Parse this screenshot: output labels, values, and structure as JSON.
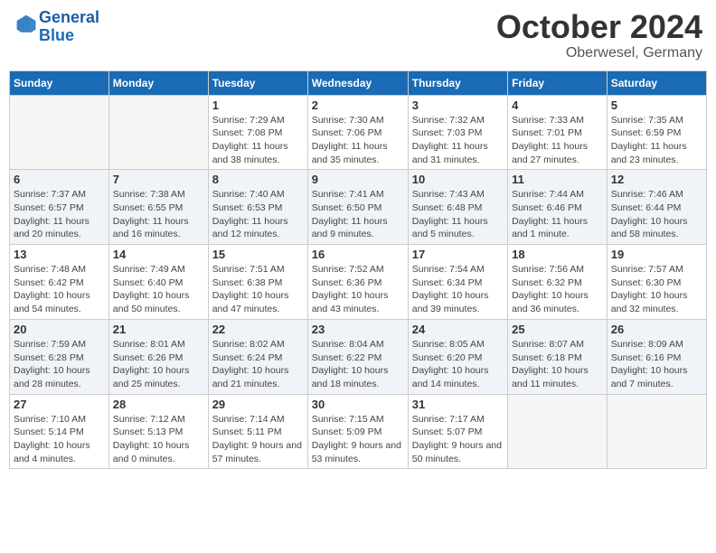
{
  "header": {
    "logo_line1": "General",
    "logo_line2": "Blue",
    "month": "October 2024",
    "location": "Oberwesel, Germany"
  },
  "weekdays": [
    "Sunday",
    "Monday",
    "Tuesday",
    "Wednesday",
    "Thursday",
    "Friday",
    "Saturday"
  ],
  "weeks": [
    [
      {
        "day": "",
        "info": ""
      },
      {
        "day": "",
        "info": ""
      },
      {
        "day": "1",
        "info": "Sunrise: 7:29 AM\nSunset: 7:08 PM\nDaylight: 11 hours and 38 minutes."
      },
      {
        "day": "2",
        "info": "Sunrise: 7:30 AM\nSunset: 7:06 PM\nDaylight: 11 hours and 35 minutes."
      },
      {
        "day": "3",
        "info": "Sunrise: 7:32 AM\nSunset: 7:03 PM\nDaylight: 11 hours and 31 minutes."
      },
      {
        "day": "4",
        "info": "Sunrise: 7:33 AM\nSunset: 7:01 PM\nDaylight: 11 hours and 27 minutes."
      },
      {
        "day": "5",
        "info": "Sunrise: 7:35 AM\nSunset: 6:59 PM\nDaylight: 11 hours and 23 minutes."
      }
    ],
    [
      {
        "day": "6",
        "info": "Sunrise: 7:37 AM\nSunset: 6:57 PM\nDaylight: 11 hours and 20 minutes."
      },
      {
        "day": "7",
        "info": "Sunrise: 7:38 AM\nSunset: 6:55 PM\nDaylight: 11 hours and 16 minutes."
      },
      {
        "day": "8",
        "info": "Sunrise: 7:40 AM\nSunset: 6:53 PM\nDaylight: 11 hours and 12 minutes."
      },
      {
        "day": "9",
        "info": "Sunrise: 7:41 AM\nSunset: 6:50 PM\nDaylight: 11 hours and 9 minutes."
      },
      {
        "day": "10",
        "info": "Sunrise: 7:43 AM\nSunset: 6:48 PM\nDaylight: 11 hours and 5 minutes."
      },
      {
        "day": "11",
        "info": "Sunrise: 7:44 AM\nSunset: 6:46 PM\nDaylight: 11 hours and 1 minute."
      },
      {
        "day": "12",
        "info": "Sunrise: 7:46 AM\nSunset: 6:44 PM\nDaylight: 10 hours and 58 minutes."
      }
    ],
    [
      {
        "day": "13",
        "info": "Sunrise: 7:48 AM\nSunset: 6:42 PM\nDaylight: 10 hours and 54 minutes."
      },
      {
        "day": "14",
        "info": "Sunrise: 7:49 AM\nSunset: 6:40 PM\nDaylight: 10 hours and 50 minutes."
      },
      {
        "day": "15",
        "info": "Sunrise: 7:51 AM\nSunset: 6:38 PM\nDaylight: 10 hours and 47 minutes."
      },
      {
        "day": "16",
        "info": "Sunrise: 7:52 AM\nSunset: 6:36 PM\nDaylight: 10 hours and 43 minutes."
      },
      {
        "day": "17",
        "info": "Sunrise: 7:54 AM\nSunset: 6:34 PM\nDaylight: 10 hours and 39 minutes."
      },
      {
        "day": "18",
        "info": "Sunrise: 7:56 AM\nSunset: 6:32 PM\nDaylight: 10 hours and 36 minutes."
      },
      {
        "day": "19",
        "info": "Sunrise: 7:57 AM\nSunset: 6:30 PM\nDaylight: 10 hours and 32 minutes."
      }
    ],
    [
      {
        "day": "20",
        "info": "Sunrise: 7:59 AM\nSunset: 6:28 PM\nDaylight: 10 hours and 28 minutes."
      },
      {
        "day": "21",
        "info": "Sunrise: 8:01 AM\nSunset: 6:26 PM\nDaylight: 10 hours and 25 minutes."
      },
      {
        "day": "22",
        "info": "Sunrise: 8:02 AM\nSunset: 6:24 PM\nDaylight: 10 hours and 21 minutes."
      },
      {
        "day": "23",
        "info": "Sunrise: 8:04 AM\nSunset: 6:22 PM\nDaylight: 10 hours and 18 minutes."
      },
      {
        "day": "24",
        "info": "Sunrise: 8:05 AM\nSunset: 6:20 PM\nDaylight: 10 hours and 14 minutes."
      },
      {
        "day": "25",
        "info": "Sunrise: 8:07 AM\nSunset: 6:18 PM\nDaylight: 10 hours and 11 minutes."
      },
      {
        "day": "26",
        "info": "Sunrise: 8:09 AM\nSunset: 6:16 PM\nDaylight: 10 hours and 7 minutes."
      }
    ],
    [
      {
        "day": "27",
        "info": "Sunrise: 7:10 AM\nSunset: 5:14 PM\nDaylight: 10 hours and 4 minutes."
      },
      {
        "day": "28",
        "info": "Sunrise: 7:12 AM\nSunset: 5:13 PM\nDaylight: 10 hours and 0 minutes."
      },
      {
        "day": "29",
        "info": "Sunrise: 7:14 AM\nSunset: 5:11 PM\nDaylight: 9 hours and 57 minutes."
      },
      {
        "day": "30",
        "info": "Sunrise: 7:15 AM\nSunset: 5:09 PM\nDaylight: 9 hours and 53 minutes."
      },
      {
        "day": "31",
        "info": "Sunrise: 7:17 AM\nSunset: 5:07 PM\nDaylight: 9 hours and 50 minutes."
      },
      {
        "day": "",
        "info": ""
      },
      {
        "day": "",
        "info": ""
      }
    ]
  ]
}
